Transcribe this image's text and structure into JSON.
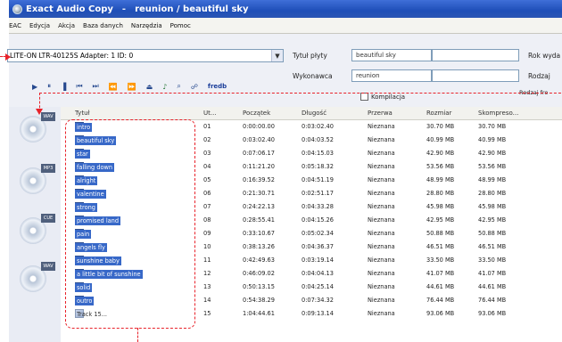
{
  "window": {
    "app_name": "Exact Audio Copy",
    "title_sep": "-",
    "title": "reunion / beautiful sky"
  },
  "menu": [
    "EAC",
    "Edycja",
    "Akcja",
    "Baza danych",
    "Narzędzia",
    "Pomoc"
  ],
  "drive": {
    "value": "LITE-ON LTR-40125S  Adapter: 1  ID: 0",
    "arrow": "▼"
  },
  "toolbar": {
    "icons": [
      "play-icon",
      "pause-icon",
      "stop-icon",
      "prev-icon",
      "next-icon",
      "rewind-icon",
      "forward-icon",
      "eject-icon"
    ],
    "logo": "fredb"
  },
  "album_fields": {
    "title_label": "Tytuł płyty",
    "title_value": "beautiful sky",
    "artist_label": "Wykonawca",
    "artist_value": "reunion",
    "compilation_label": "Kompilacja",
    "year_label": "Rok wyda",
    "genre_label": "Rodzaj",
    "genre_type_label": "Rodzaj fre"
  },
  "columns": [
    "Tytuł",
    "Ut...",
    "Początek",
    "Długość",
    "Przerwa",
    "Rozmiar",
    "Skompreso..."
  ],
  "tracks": [
    {
      "name": "intro",
      "num": "01",
      "start": "0:00:00.00",
      "length": "0:03:02.40",
      "gap": "Nieznana",
      "size": "30.70 MB",
      "comp": "30.70 MB",
      "selected": true
    },
    {
      "name": "beautiful sky",
      "num": "02",
      "start": "0:03:02.40",
      "length": "0:04:03.52",
      "gap": "Nieznana",
      "size": "40.99 MB",
      "comp": "40.99 MB",
      "selected": true
    },
    {
      "name": "star",
      "num": "03",
      "start": "0:07:06.17",
      "length": "0:04:15.03",
      "gap": "Nieznana",
      "size": "42.90 MB",
      "comp": "42.90 MB",
      "selected": true
    },
    {
      "name": "falling down",
      "num": "04",
      "start": "0:11:21.20",
      "length": "0:05:18.32",
      "gap": "Nieznana",
      "size": "53.56 MB",
      "comp": "53.56 MB",
      "selected": true
    },
    {
      "name": "alright",
      "num": "05",
      "start": "0:16:39.52",
      "length": "0:04:51.19",
      "gap": "Nieznana",
      "size": "48.99 MB",
      "comp": "48.99 MB",
      "selected": true
    },
    {
      "name": "valentine",
      "num": "06",
      "start": "0:21:30.71",
      "length": "0:02:51.17",
      "gap": "Nieznana",
      "size": "28.80 MB",
      "comp": "28.80 MB",
      "selected": true
    },
    {
      "name": "strong",
      "num": "07",
      "start": "0:24:22.13",
      "length": "0:04:33.28",
      "gap": "Nieznana",
      "size": "45.98 MB",
      "comp": "45.98 MB",
      "selected": true
    },
    {
      "name": "promised land",
      "num": "08",
      "start": "0:28:55.41",
      "length": "0:04:15.26",
      "gap": "Nieznana",
      "size": "42.95 MB",
      "comp": "42.95 MB",
      "selected": true
    },
    {
      "name": "pain",
      "num": "09",
      "start": "0:33:10.67",
      "length": "0:05:02.34",
      "gap": "Nieznana",
      "size": "50.88 MB",
      "comp": "50.88 MB",
      "selected": true
    },
    {
      "name": "angels fly",
      "num": "10",
      "start": "0:38:13.26",
      "length": "0:04:36.37",
      "gap": "Nieznana",
      "size": "46.51 MB",
      "comp": "46.51 MB",
      "selected": true
    },
    {
      "name": "sunshine baby",
      "num": "11",
      "start": "0:42:49.63",
      "length": "0:03:19.14",
      "gap": "Nieznana",
      "size": "33.50 MB",
      "comp": "33.50 MB",
      "selected": true
    },
    {
      "name": "a little bit of sunshine",
      "num": "12",
      "start": "0:46:09.02",
      "length": "0:04:04.13",
      "gap": "Nieznana",
      "size": "41.07 MB",
      "comp": "41.07 MB",
      "selected": true
    },
    {
      "name": "solid",
      "num": "13",
      "start": "0:50:13.15",
      "length": "0:04:25.14",
      "gap": "Nieznana",
      "size": "44.61 MB",
      "comp": "44.61 MB",
      "selected": true
    },
    {
      "name": "outro",
      "num": "14",
      "start": "0:54:38.29",
      "length": "0:07:34.32",
      "gap": "Nieznana",
      "size": "76.44 MB",
      "comp": "76.44 MB",
      "selected": true
    },
    {
      "name": "Track 15...",
      "num": "15",
      "start": "1:04:44.61",
      "length": "0:09:13.14",
      "gap": "Nieznana",
      "size": "93.06 MB",
      "comp": "93.06 MB",
      "selected": false
    }
  ],
  "side_buttons": [
    "WAV",
    "MP3",
    "CUE",
    "WAV"
  ],
  "colors": {
    "titlebar": "#2a55b4",
    "selection": "#3768c8",
    "annotation": "#e8222a"
  }
}
